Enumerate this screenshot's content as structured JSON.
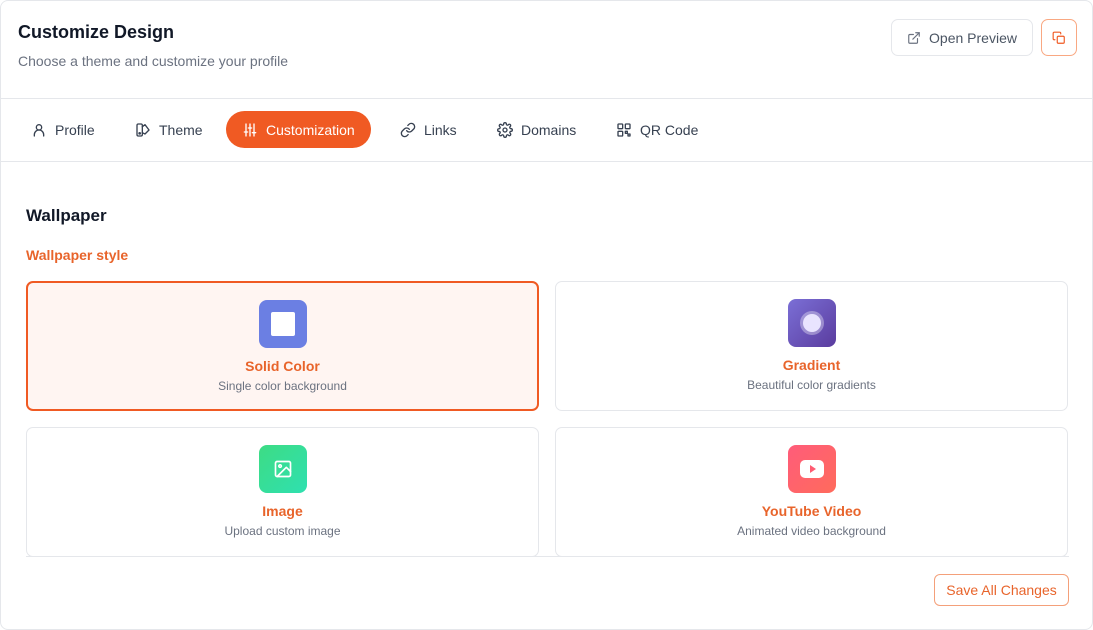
{
  "header": {
    "title": "Customize Design",
    "subtitle": "Choose a theme and customize your profile",
    "preview_label": "Open Preview",
    "preview_icon": "external-link-icon",
    "copy_icon": "copy-icon"
  },
  "tabs": [
    {
      "label": "Profile",
      "icon": "user-icon",
      "active": false
    },
    {
      "label": "Theme",
      "icon": "palette-icon",
      "active": false
    },
    {
      "label": "Customization",
      "icon": "sliders-icon",
      "active": true
    },
    {
      "label": "Links",
      "icon": "link-icon",
      "active": false
    },
    {
      "label": "Domains",
      "icon": "gear-icon",
      "active": false
    },
    {
      "label": "QR Code",
      "icon": "qr-code-icon",
      "active": false
    }
  ],
  "wallpaper": {
    "title": "Wallpaper",
    "style_label": "Wallpaper style",
    "options": [
      {
        "name": "Solid Color",
        "description": "Single color background",
        "icon": "square-icon",
        "selected": true
      },
      {
        "name": "Gradient",
        "description": "Beautiful color gradients",
        "icon": "circle-icon",
        "selected": false
      },
      {
        "name": "Image",
        "description": "Upload custom image",
        "icon": "image-icon",
        "selected": false
      },
      {
        "name": "YouTube Video",
        "description": "Animated video background",
        "icon": "youtube-icon",
        "selected": false
      }
    ]
  },
  "footer": {
    "save_label": "Save All Changes"
  },
  "colors": {
    "accent": "#f05a23",
    "accent_text": "#e8642b",
    "selected_bg": "#fff5f2",
    "solid_icon_bg": "#6b7fe3",
    "gradient_icon_from": "#7b6fd6",
    "gradient_icon_to": "#5a3c9e",
    "image_icon_from": "#3ddc84",
    "image_icon_to": "#2fe0b0",
    "youtube_icon_from": "#ff5c7a",
    "youtube_icon_to": "#ff6b5c"
  }
}
